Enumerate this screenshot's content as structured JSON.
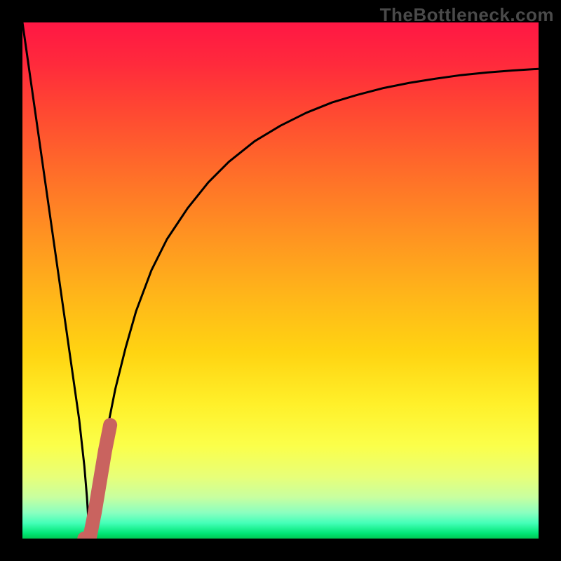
{
  "watermark": "TheBottleneck.com",
  "colors": {
    "frame": "#000000",
    "curve": "#000000",
    "marker_fill": "#c9635f",
    "marker_stroke": "#c9635f"
  },
  "chart_data": {
    "type": "line",
    "title": "",
    "xlabel": "",
    "ylabel": "",
    "xlim": [
      0,
      100
    ],
    "ylim": [
      0,
      100
    ],
    "grid": false,
    "legend": false,
    "series": [
      {
        "name": "bottleneck-curve",
        "x": [
          0,
          2,
          4,
          6,
          8,
          10,
          11,
          12,
          12.5,
          13,
          14,
          16,
          18,
          20,
          22,
          25,
          28,
          32,
          36,
          40,
          45,
          50,
          55,
          60,
          65,
          70,
          75,
          80,
          85,
          90,
          95,
          100
        ],
        "y": [
          100,
          86,
          72,
          58,
          44,
          30,
          23,
          14,
          8,
          0,
          7,
          19,
          29,
          37,
          44,
          52,
          58,
          64,
          69,
          73,
          77,
          80,
          82.5,
          84.5,
          86,
          87.3,
          88.3,
          89.1,
          89.8,
          90.3,
          90.7,
          91
        ]
      },
      {
        "name": "sweet-spot-marker",
        "x": [
          12,
          12.5,
          13,
          14,
          15,
          16,
          17
        ],
        "y": [
          0,
          0,
          0,
          5,
          11,
          17,
          22
        ]
      }
    ],
    "annotations": []
  }
}
